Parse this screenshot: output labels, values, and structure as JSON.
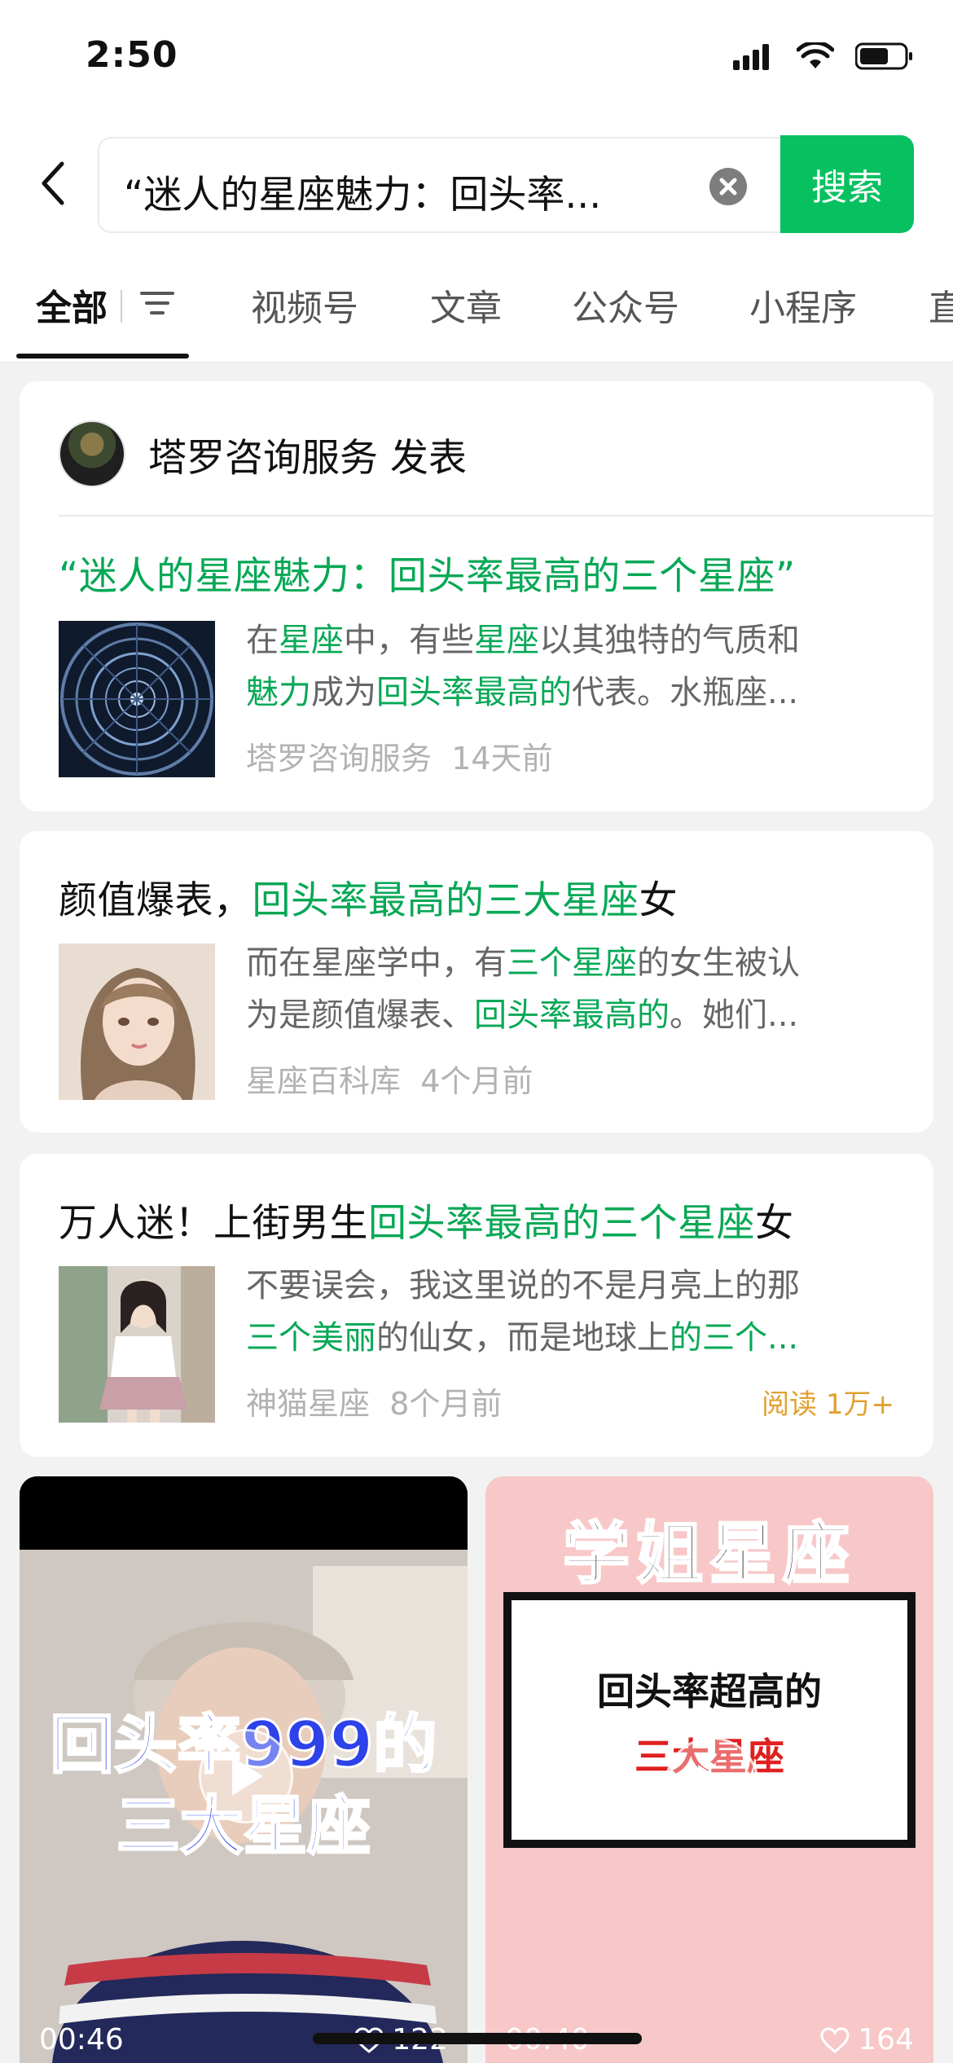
{
  "status_bar": {
    "time": "2:50"
  },
  "search": {
    "query": "“迷人的星座魅力：回头率...",
    "button_label": "搜索"
  },
  "tabs": [
    {
      "label": "全部",
      "active": true
    },
    {
      "label": "视频号"
    },
    {
      "label": "文章"
    },
    {
      "label": "公众号"
    },
    {
      "label": "小程序"
    },
    {
      "label": "直"
    }
  ],
  "results": [
    {
      "author": "塔罗咨询服务 发表",
      "title_parts": [
        "“迷人的星座魅力：回头率最高的三个星座”"
      ],
      "snippet_line1": [
        "在",
        "星座",
        "中，有些",
        "星座",
        "以其独特的气质和"
      ],
      "snippet_line2": [
        "魅力",
        "成为",
        "回头率最高的",
        "代表。水瓶座..."
      ],
      "source": "塔罗咨询服务",
      "time": "14天前"
    },
    {
      "title_parts": [
        "颜值爆表，",
        "回头率最高的三大星座",
        "女"
      ],
      "snippet_line1": [
        "而在星座学中，有",
        "三个星座",
        "的女生被认"
      ],
      "snippet_line2": [
        "为是颜值爆表、",
        "回头率最高的",
        "。她们..."
      ],
      "source": "星座百科库",
      "time": "4个月前"
    },
    {
      "title_parts": [
        "万人迷！上街男生",
        "回头率最高的三个星座",
        "女"
      ],
      "snippet_line1": [
        "不要误会，我这里说的不是月亮上的那"
      ],
      "snippet_line2": [
        "三个美丽",
        "的仙女，而是地球上",
        "的三个..."
      ],
      "source": "神猫星座",
      "time": "8个月前",
      "read_count": "阅读 1万+"
    }
  ],
  "videos": [
    {
      "overlay_line1": "回头率999的",
      "overlay_line2": "三大星座",
      "duration": "00:46",
      "likes": "122"
    },
    {
      "header": "学姐星座",
      "card_line1": "回头率超高的",
      "card_line2": "三大星座",
      "duration": "00:40",
      "likes": "164"
    }
  ],
  "colors": {
    "accent": "#07c160",
    "highlight": "#07a856",
    "read": "#e0a130"
  }
}
